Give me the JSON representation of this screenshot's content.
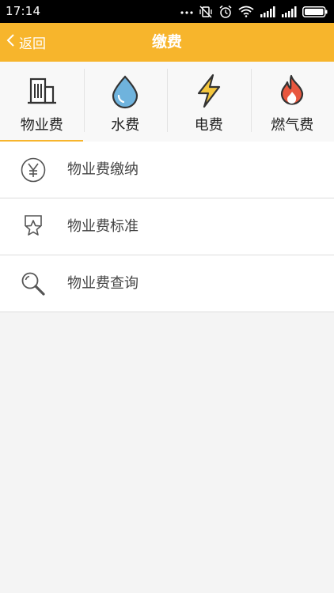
{
  "status_bar": {
    "time": "17:14",
    "icons": [
      "more-dots-icon",
      "vibrate-off-icon",
      "alarm-icon",
      "wifi-icon",
      "signal-icon",
      "signal-icon",
      "battery-icon"
    ]
  },
  "header": {
    "back_label": "返回",
    "title": "缴费"
  },
  "tabs": [
    {
      "label": "物业费",
      "icon": "building-icon",
      "active": true
    },
    {
      "label": "水费",
      "icon": "water-drop-icon",
      "active": false
    },
    {
      "label": "电费",
      "icon": "lightning-icon",
      "active": false
    },
    {
      "label": "燃气费",
      "icon": "flame-icon",
      "active": false
    }
  ],
  "list": [
    {
      "label": "物业费缴纳",
      "icon": "yen-icon"
    },
    {
      "label": "物业费标准",
      "icon": "star-badge-icon"
    },
    {
      "label": "物业费查询",
      "icon": "search-icon"
    }
  ],
  "colors": {
    "accent": "#f7b52c",
    "water": "#6fb3dd",
    "lightning": "#f4c63d",
    "flame": "#e8573f"
  }
}
